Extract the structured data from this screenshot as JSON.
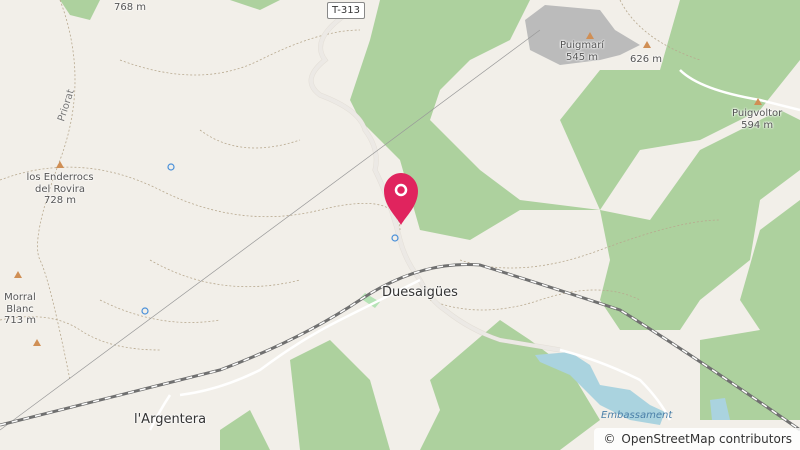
{
  "map": {
    "road_ref": "T-313",
    "top_elevation": "768 m",
    "ridge_name": "Priorat",
    "places": {
      "duesaigues": "Duesaigües",
      "argentera": "l'Argentera"
    },
    "peaks": [
      {
        "name": "Puigmarí",
        "elevation": "545 m"
      },
      {
        "name": "",
        "elevation": "626 m"
      },
      {
        "name": "Puigvoltor",
        "elevation": "594 m"
      },
      {
        "name": "los Enderrocs del Rovira",
        "elevation": "728 m"
      },
      {
        "name": "Morral Blanc",
        "elevation": "713 m"
      }
    ],
    "water_label": "Embassament",
    "attribution": {
      "symbol": "©",
      "text": "OpenStreetMap contributors"
    },
    "colors": {
      "background": "#f2efe9",
      "forest": "#add19e",
      "water": "#aad3df",
      "railway": "#707070",
      "marker": "#e0245e"
    }
  }
}
